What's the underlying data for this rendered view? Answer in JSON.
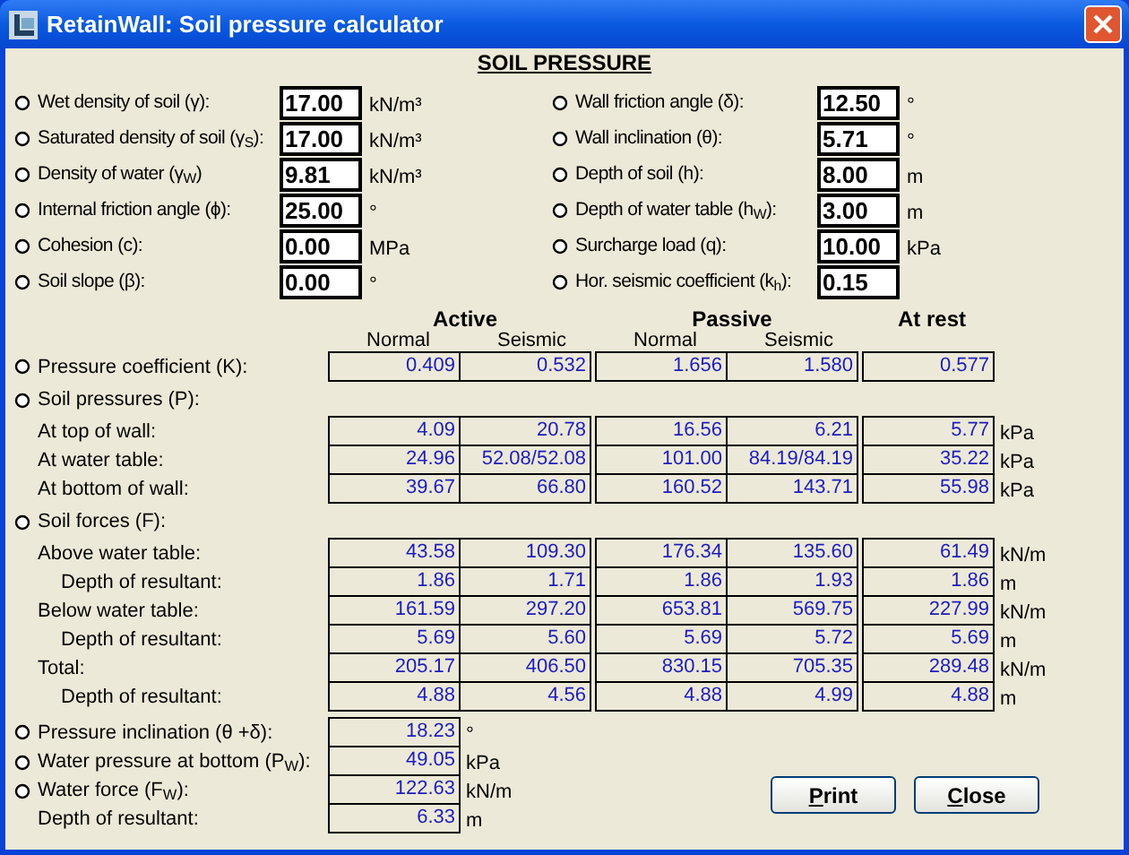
{
  "window": {
    "title": "RetainWall: Soil pressure calculator"
  },
  "heading": "SOIL PRESSURE",
  "inputs_left": [
    {
      "label": "Wet density of soil (γ):",
      "value": "17.00",
      "unit": "kN/m³"
    },
    {
      "label": "Saturated density of soil (γ$_{S}$):",
      "value": "17.00",
      "unit": "kN/m³"
    },
    {
      "label": "Density of water (γ$_{W}$)",
      "value": "9.81",
      "unit": "kN/m³"
    },
    {
      "label": "Internal friction angle (ϕ):",
      "value": "25.00",
      "unit": "°"
    },
    {
      "label": "Cohesion (c):",
      "value": "0.00",
      "unit": "MPa"
    },
    {
      "label": "Soil slope (β):",
      "value": "0.00",
      "unit": "°"
    }
  ],
  "inputs_right": [
    {
      "label": "Wall friction angle (δ):",
      "value": "12.50",
      "unit": "°"
    },
    {
      "label": "Wall inclination (θ):",
      "value": "5.71",
      "unit": "°"
    },
    {
      "label": "Depth of soil (h):",
      "value": "8.00",
      "unit": "m"
    },
    {
      "label": "Depth of water table (h$_{W}$):",
      "value": "3.00",
      "unit": "m"
    },
    {
      "label": "Surcharge load (q):",
      "value": "10.00",
      "unit": "kPa"
    },
    {
      "label": "Hor. seismic coefficient (k$_{h}$):",
      "value": "0.15"
    }
  ],
  "groups": [
    {
      "title": "Active",
      "columns": [
        "Normal",
        "Seismic"
      ]
    },
    {
      "title": "Passive",
      "columns": [
        "Normal",
        "Seismic"
      ]
    },
    {
      "title": "At rest"
    }
  ],
  "sections": [
    {
      "label": "Pressure coefficient (K):",
      "values": [
        "0.409",
        "0.532",
        "1.656",
        "1.580",
        "0.577"
      ]
    },
    {
      "label": "Soil pressures (P):",
      "rows": [
        {
          "label": "At top of wall:",
          "values": [
            "4.09",
            "20.78",
            "16.56",
            "6.21",
            "5.77"
          ],
          "unit": "kPa"
        },
        {
          "label": "At water table:",
          "values": [
            "24.96",
            "52.08/52.08",
            "101.00",
            "84.19/84.19",
            "35.22"
          ],
          "unit": "kPa"
        },
        {
          "label": "At bottom of wall:",
          "values": [
            "39.67",
            "66.80",
            "160.52",
            "143.71",
            "55.98"
          ],
          "unit": "kPa"
        }
      ]
    },
    {
      "label": "Soil forces (F):",
      "rows": [
        {
          "label": "Above water table:",
          "values": [
            "43.58",
            "109.30",
            "176.34",
            "135.60",
            "61.49"
          ],
          "unit": "kN/m",
          "children": [
            {
              "label": "Depth of resultant:",
              "values": [
                "1.86",
                "1.71",
                "1.86",
                "1.93",
                "1.86"
              ],
              "unit": "m"
            }
          ]
        },
        {
          "label": "Below water table:",
          "values": [
            "161.59",
            "297.20",
            "653.81",
            "569.75",
            "227.99"
          ],
          "unit": "kN/m",
          "children": [
            {
              "label": "Depth of resultant:",
              "values": [
                "5.69",
                "5.60",
                "5.69",
                "5.72",
                "5.69"
              ],
              "unit": "m"
            }
          ]
        },
        {
          "label": "Total:",
          "values": [
            "205.17",
            "406.50",
            "830.15",
            "705.35",
            "289.48"
          ],
          "unit": "kN/m",
          "children": [
            {
              "label": "Depth of resultant:",
              "values": [
                "4.88",
                "4.56",
                "4.88",
                "4.99",
                "4.88"
              ],
              "unit": "m"
            }
          ]
        }
      ]
    }
  ],
  "water": [
    {
      "label": "Pressure inclination (θ +δ):",
      "bullet": true,
      "value": "18.23",
      "unit": "°"
    },
    {
      "label": "Water pressure at bottom (P$_{W}$):",
      "bullet": true,
      "value": "49.05",
      "unit": "kPa"
    },
    {
      "label": "Water force (F$_{W}$):",
      "bullet": true,
      "value": "122.63",
      "unit": "kN/m"
    },
    {
      "label": "Depth of resultant:",
      "bullet": false,
      "value": "6.33",
      "unit": "m"
    }
  ],
  "buttons": [
    "Print",
    "Close"
  ]
}
